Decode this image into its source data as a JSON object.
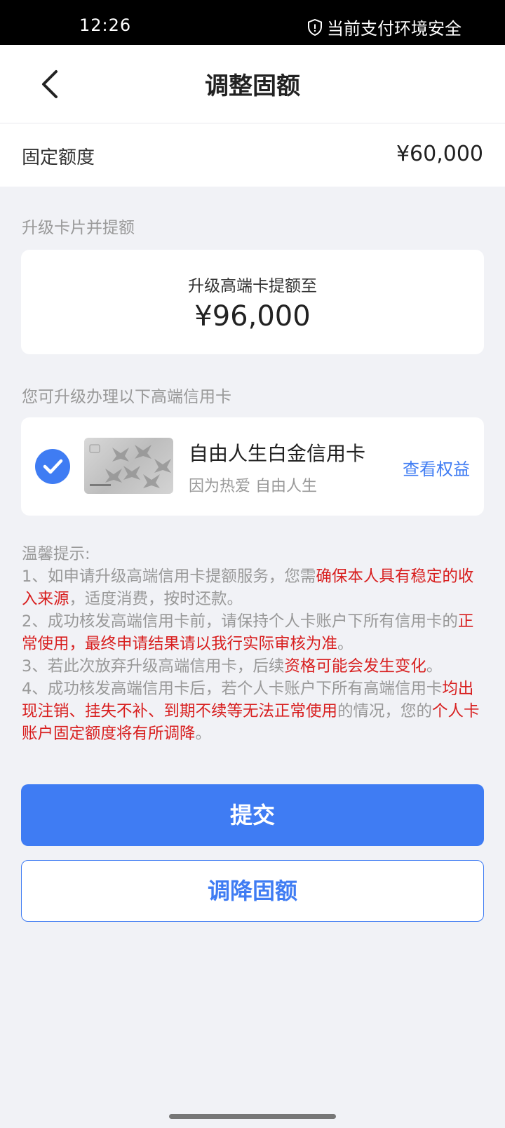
{
  "status_bar": {
    "time": "12:26",
    "security_text": "当前支付环境安全"
  },
  "header": {
    "title": "调整固额"
  },
  "fixed_limit": {
    "label": "固定额度",
    "value": "¥60,000"
  },
  "upgrade": {
    "section_title": "升级卡片并提额",
    "subtitle": "升级高端卡提额至",
    "amount": "¥96,000"
  },
  "cards": {
    "section_title": "您可升级办理以下高端信用卡",
    "item": {
      "name": "自由人生白金信用卡",
      "slogan": "因为热爱 自由人生",
      "benefit_link": "查看权益",
      "selected": true
    }
  },
  "tips": {
    "title": "温馨提示:",
    "tip1_a": "1、如申请升级高端信用卡提额服务，您需",
    "tip1_b": "确保本人具有稳定的收入来源",
    "tip1_c": "，适度消费，按时还款。",
    "tip2_a": "2、成功核发高端信用卡前，请保持个人卡账户下所有信用卡的",
    "tip2_b": "正常使用",
    "tip2_c": "，",
    "tip2_d": "最终申请结果请以我行实际审核为准",
    "tip2_e": "。",
    "tip3_a": "3、若此次放弃升级高端信用卡，后续",
    "tip3_b": "资格可能会发生变化",
    "tip3_c": "。",
    "tip4_a": "4、成功核发高端信用卡后，若个人卡账户下所有高端信用卡",
    "tip4_b": "均出现注销、挂失不补、到期不续等无法正常使用",
    "tip4_c": "的情况，您的",
    "tip4_d": "个人卡账户固定额度将有所调降",
    "tip4_e": "。"
  },
  "buttons": {
    "submit": "提交",
    "lower_limit": "调降固额"
  },
  "colors": {
    "accent": "#3f7cf3",
    "warning_text": "#d81e1e",
    "background": "#f1f2f6"
  },
  "icons": {
    "security": "shield-icon",
    "back": "chevron-left-icon",
    "check": "check-circle-icon"
  }
}
